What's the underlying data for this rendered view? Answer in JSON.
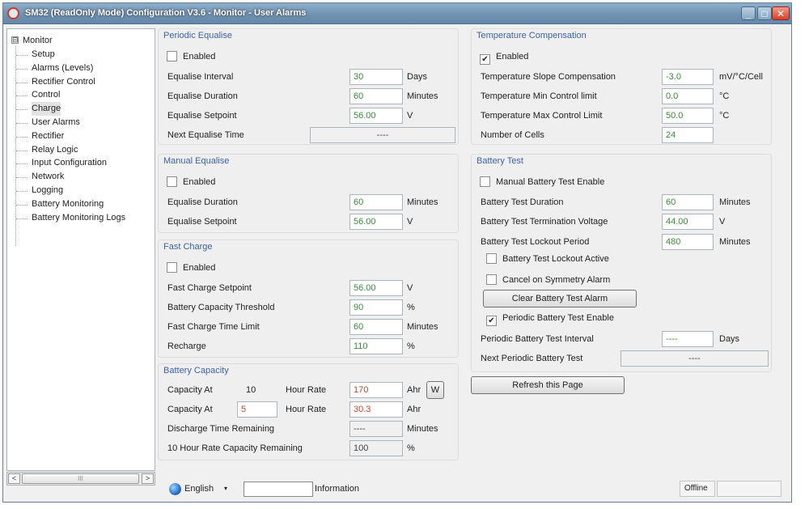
{
  "window": {
    "title": "SM32 (ReadOnly Mode) Configuration V3.6 - Monitor - User Alarms",
    "minimize_glyph": "_",
    "maximize_glyph": "□",
    "close_glyph": "✕"
  },
  "tree": {
    "root": "Monitor",
    "expander": "⊟",
    "items": [
      {
        "label": "Setup"
      },
      {
        "label": "Alarms (Levels)"
      },
      {
        "label": "Rectifier Control"
      },
      {
        "label": "Control"
      },
      {
        "label": "Charge"
      },
      {
        "label": "User Alarms"
      },
      {
        "label": "Rectifier"
      },
      {
        "label": "Relay Logic"
      },
      {
        "label": "Input Configuration"
      },
      {
        "label": "Network"
      },
      {
        "label": "Logging"
      },
      {
        "label": "Battery Monitoring"
      },
      {
        "label": "Battery Monitoring Logs"
      }
    ],
    "selected": "Charge",
    "scroll": {
      "left": "<",
      "right": ">",
      "grip": "III"
    }
  },
  "periodic_equalise": {
    "title": "Periodic Equalise",
    "enabled": {
      "label": "Enabled",
      "checked": false
    },
    "interval": {
      "label": "Equalise Interval",
      "value": "30",
      "unit": "Days"
    },
    "duration": {
      "label": "Equalise Duration",
      "value": "60",
      "unit": "Minutes"
    },
    "setpoint": {
      "label": "Equalise Setpoint",
      "value": "56.00",
      "unit": "V"
    },
    "next_time": {
      "label": "Next Equalise Time",
      "value": "----"
    }
  },
  "manual_equalise": {
    "title": "Manual Equalise",
    "enabled": {
      "label": "Enabled",
      "checked": false
    },
    "duration": {
      "label": "Equalise Duration",
      "value": "60",
      "unit": "Minutes"
    },
    "setpoint": {
      "label": "Equalise Setpoint",
      "value": "56.00",
      "unit": "V"
    }
  },
  "fast_charge": {
    "title": "Fast Charge",
    "enabled": {
      "label": "Enabled",
      "checked": false
    },
    "setpoint": {
      "label": "Fast Charge Setpoint",
      "value": "56.00",
      "unit": "V"
    },
    "capacity_threshold": {
      "label": "Battery Capacity Threshold",
      "value": "90",
      "unit": "%"
    },
    "time_limit": {
      "label": "Fast Charge Time Limit",
      "value": "60",
      "unit": "Minutes"
    },
    "recharge": {
      "label": "Recharge",
      "value": "110",
      "unit": "%"
    }
  },
  "battery_capacity": {
    "title": "Battery Capacity",
    "row1": {
      "label": "Capacity At",
      "hours": "10",
      "rate_label": "Hour Rate",
      "value": "170",
      "unit": "Ahr",
      "button": "W"
    },
    "row2": {
      "label": "Capacity At",
      "hours": "5",
      "rate_label": "Hour Rate",
      "value": "30.3",
      "unit": "Ahr"
    },
    "discharge_remaining": {
      "label": "Discharge Time Remaining",
      "value": "----",
      "unit": "Minutes"
    },
    "rate_capacity_remaining": {
      "label": "10 Hour Rate Capacity Remaining",
      "value": "100",
      "unit": "%"
    }
  },
  "temperature_compensation": {
    "title": "Temperature Compensation",
    "enabled": {
      "label": "Enabled",
      "checked": true
    },
    "slope": {
      "label": "Temperature Slope Compensation",
      "value": "-3.0",
      "unit": "mV/°C/Cell"
    },
    "min_limit": {
      "label": "Temperature Min Control limit",
      "value": "0.0",
      "unit": "°C"
    },
    "max_limit": {
      "label": "Temperature Max Control Limit",
      "value": "50.0",
      "unit": "°C"
    },
    "cells": {
      "label": "Number of Cells",
      "value": "24"
    }
  },
  "battery_test": {
    "title": "Battery Test",
    "manual_enable": {
      "label": "Manual Battery Test Enable",
      "checked": false
    },
    "duration": {
      "label": "Battery Test Duration",
      "value": "60",
      "unit": "Minutes"
    },
    "termination_voltage": {
      "label": "Battery Test Termination Voltage",
      "value": "44.00",
      "unit": "V"
    },
    "lockout_period": {
      "label": "Battery Test Lockout Period",
      "value": "480",
      "unit": "Minutes"
    },
    "lockout_active": {
      "label": "Battery Test Lockout Active",
      "checked": false
    },
    "cancel_symmetry": {
      "label": "Cancel on Symmetry Alarm",
      "checked": false
    },
    "clear_alarm_button": "Clear Battery Test Alarm",
    "periodic_enable": {
      "label": "Periodic Battery Test Enable",
      "checked": true
    },
    "periodic_interval": {
      "label": "Periodic Battery Test Interval",
      "value": "----",
      "unit": "Days"
    },
    "next_periodic": {
      "label": "Next Periodic Battery Test",
      "value": "----"
    }
  },
  "refresh_button": "Refresh this Page",
  "status": {
    "language": "English",
    "language_caret": "▾",
    "info_label": "Information",
    "connection": "Offline"
  },
  "colors": {
    "group_title": "#3b63a7",
    "value_green": "#3b8a3b",
    "value_red": "#c8442a"
  }
}
